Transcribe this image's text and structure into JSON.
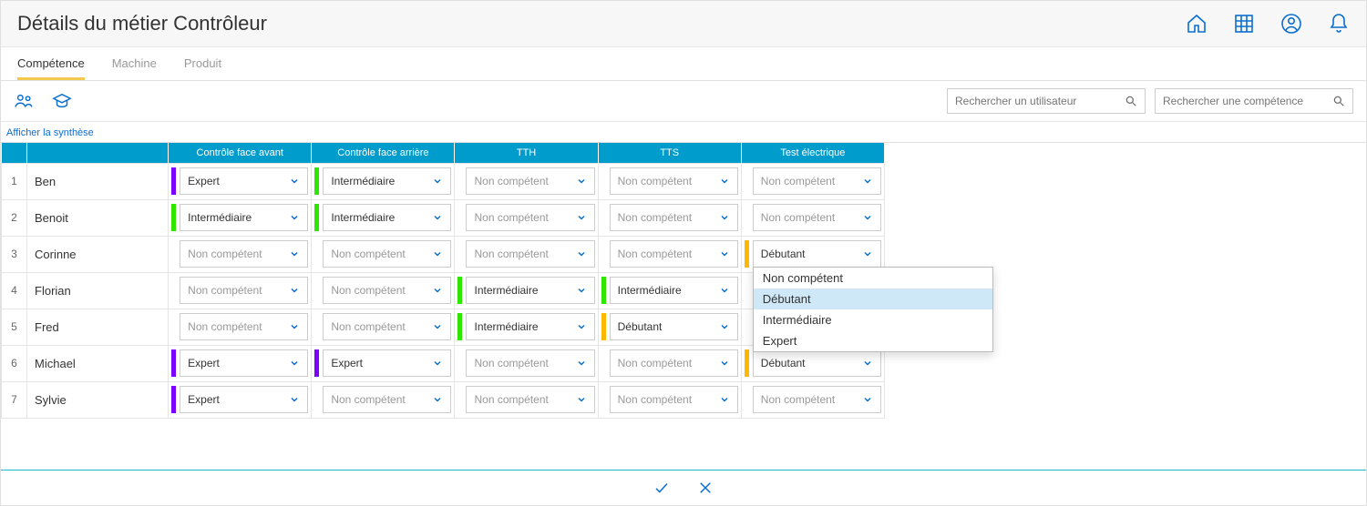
{
  "header": {
    "title": "Détails du métier Contrôleur"
  },
  "tabs": [
    {
      "id": "competence",
      "label": "Compétence",
      "active": true
    },
    {
      "id": "machine",
      "label": "Machine",
      "active": false
    },
    {
      "id": "produit",
      "label": "Produit",
      "active": false
    }
  ],
  "search": {
    "user_placeholder": "Rechercher un utilisateur",
    "skill_placeholder": "Rechercher une compétence"
  },
  "summary_link": "Afficher la synthèse",
  "columns": [
    "Contrôle face avant",
    "Contrôle face arrière",
    "TTH",
    "TTS",
    "Test électrique"
  ],
  "level_labels": {
    "none": "Non compétent",
    "beginner": "Débutant",
    "intermediate": "Intermédiaire",
    "expert": "Expert"
  },
  "stripe_colors": {
    "none": "none",
    "beginner": "orange",
    "intermediate": "green",
    "expert": "purple"
  },
  "rows": [
    {
      "num": "1",
      "name": "Ben",
      "skills": [
        "expert",
        "intermediate",
        "none",
        "none",
        "none"
      ]
    },
    {
      "num": "2",
      "name": "Benoit",
      "skills": [
        "intermediate",
        "intermediate",
        "none",
        "none",
        "none"
      ]
    },
    {
      "num": "3",
      "name": "Corinne",
      "skills": [
        "none",
        "none",
        "none",
        "none",
        "beginner"
      ]
    },
    {
      "num": "4",
      "name": "Florian",
      "skills": [
        "none",
        "none",
        "intermediate",
        "intermediate",
        "none"
      ]
    },
    {
      "num": "5",
      "name": "Fred",
      "skills": [
        "none",
        "none",
        "intermediate",
        "beginner",
        "none"
      ]
    },
    {
      "num": "6",
      "name": "Michael",
      "skills": [
        "expert",
        "expert",
        "none",
        "none",
        "beginner"
      ]
    },
    {
      "num": "7",
      "name": "Sylvie",
      "skills": [
        "expert",
        "none",
        "none",
        "none",
        "none"
      ]
    }
  ],
  "dropdown": {
    "open_for": {
      "row": 2,
      "col": 4
    },
    "options": [
      "none",
      "beginner",
      "intermediate",
      "expert"
    ],
    "selected": "beginner"
  },
  "icons": {
    "home": "home-icon",
    "grid": "grid-icon",
    "user": "user-icon",
    "bell": "bell-icon",
    "people": "people-icon",
    "grad": "graduation-cap-icon",
    "search": "search-icon",
    "chevron": "chevron-down-icon",
    "check": "check-icon",
    "close": "close-icon"
  }
}
